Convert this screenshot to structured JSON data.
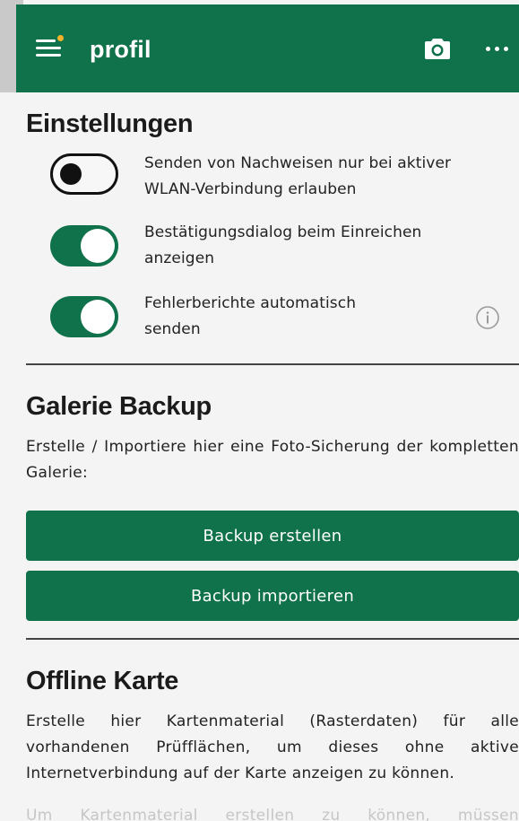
{
  "appbar": {
    "title": "profil",
    "menu_icon": "menu-icon",
    "camera_icon": "camera-icon",
    "more_icon": "more-icon",
    "background": "#10724a",
    "notification_dot": "#f2b32a"
  },
  "settings": {
    "heading": "Einstellungen",
    "items": [
      {
        "label": "Senden von Nachweisen nur bei aktiver WLAN-Verbindung erlauben",
        "enabled": false
      },
      {
        "label": "Bestätigungsdialog beim Einreichen anzeigen",
        "enabled": true
      },
      {
        "label": "Fehlerberichte automatisch senden",
        "enabled": true
      }
    ],
    "info_icon": "info-icon"
  },
  "gallery_backup": {
    "heading": "Galerie Backup",
    "description": "Erstelle / Importiere hier eine Foto-Sicherung der kompletten Galerie:",
    "create_button": "Backup erstellen",
    "import_button": "Backup importieren"
  },
  "offline_map": {
    "heading": "Offline Karte",
    "description": "Erstelle hier Kartenmaterial (Rasterdaten) für alle vorhandenen Prüfflächen, um dieses ohne aktive Internetverbindung auf der Karte anzeigen zu können.",
    "hint": "Um Kartenmaterial erstellen zu können, müssen"
  }
}
